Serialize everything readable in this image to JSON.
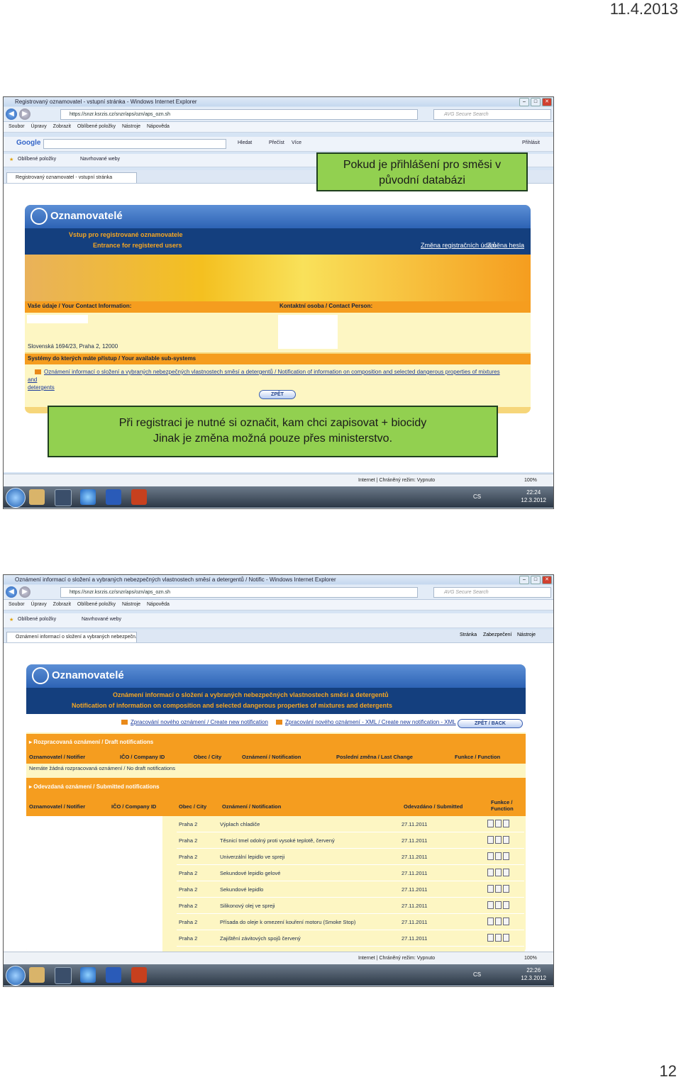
{
  "page": {
    "date": "11.4.2013",
    "number": "12"
  },
  "shot1": {
    "window_title": "Registrovaný oznamovatel - vstupní stránka - Windows Internet Explorer",
    "url": "https://snzr.ksrzis.cz/snzr/aps/ozn/aps_ozn.sh",
    "search_placeholder": "AVG Secure Search",
    "menu": [
      "Soubor",
      "Úpravy",
      "Zobrazit",
      "Oblíbené položky",
      "Nástroje",
      "Nápověda"
    ],
    "google_label": "Google",
    "google_hledat": "Hledat",
    "google_precist": "Přečíst",
    "google_vice": "Více",
    "google_prihlasit": "Přihlásit",
    "fav_label": "Oblíbené položky",
    "fav_suggested": "Navrhované weby",
    "tab_label": "Registrovaný oznamovatel - vstupní stránka",
    "app_name": "Oznamovatelé",
    "band_line1": "Vstup pro registrované oznamovatele",
    "band_line2": "Entrance for registered users",
    "link_change_reg": "Změna registračních údajů",
    "link_change_pwd": "Změna hesla",
    "contact_info_label": "Vaše údaje / Your Contact Information:",
    "contact_person_label": "Kontaktní osoba / Contact Person:",
    "address": "Slovenská 1694/23, Praha 2, 12000",
    "subsystems_label": "Systémy do kterých máte přístup / Your available sub-systems",
    "subsystem_link_line1": "Oznámení informací o složení a vybraných nebezpečných vlastnostech směsí a detergentů / Notification of information on composition and selected dangerous properties of mixtures and",
    "subsystem_link_line2": "detergents",
    "back_button": "ZPĚT",
    "status_zone": "Internet | Chráněný režim: Vypnuto",
    "zoom": "100%",
    "lang": "CS",
    "clock_time": "22:24",
    "clock_date": "12.3.2012"
  },
  "callout_top": {
    "line1": "Pokud je přihlášení pro směsi v",
    "line2": "původní databázi"
  },
  "callout_mid": {
    "line1": "Při registraci je nutné si označit, kam chci zapisovat + biocidy",
    "line2": "Jinak je změna možná pouze přes ministerstvo."
  },
  "shot2": {
    "window_title": "Oznámení informací o složení a vybraných nebezpečných vlastnostech směsí a detergentů / Notific - Windows Internet Explorer",
    "url": "https://snzr.ksrzis.cz/snzr/aps/ozn/aps_ozn.sh",
    "search_placeholder": "AVG Secure Search",
    "menu": [
      "Soubor",
      "Úpravy",
      "Zobrazit",
      "Oblíbené položky",
      "Nástroje",
      "Nápověda"
    ],
    "fav_label": "Oblíbené položky",
    "fav_suggested": "Navrhované weby",
    "tab_label": "Oznámení informací o složení a vybraných nebezpečn...",
    "cmd_stranka": "Stránka",
    "cmd_zabezpeceni": "Zabezpečení",
    "cmd_nastroje": "Nástroje",
    "app_name": "Oznamovatelé",
    "band_line1": "Oznámení informací o složení a vybraných nebezpečných vlastnostech směsí a detergentů",
    "band_line2": "Notification of information on composition and selected dangerous properties of mixtures and detergents",
    "action_new": "Zpracování nového oznámení / Create new notification",
    "action_xml": "Zpracování nového oznámení - XML / Create new notification - XML",
    "back_button": "ZPĚT / BACK",
    "draft_header": "Rozpracovaná oznámení / Draft notifications",
    "draft_columns": [
      "Oznamovatel / Notifier",
      "IČO / Company ID",
      "Obec / City",
      "Oznámení / Notification",
      "Poslední změna / Last Change",
      "Funkce / Function"
    ],
    "draft_empty": "Nemáte žádná rozpracovaná oznámení / No draft notifications",
    "submitted_header": "Odevzdaná oznámení / Submitted notifications",
    "submitted_columns": [
      "Oznamovatel / Notifier",
      "IČO / Company ID",
      "Obec / City",
      "Oznámení / Notification",
      "Odevzdáno / Submitted",
      "Funkce / Function"
    ],
    "rows": [
      {
        "city": "Praha 2",
        "notification": "Výplach chladiče",
        "submitted": "27.11.2011"
      },
      {
        "city": "Praha 2",
        "notification": "Těsnicí tmel odolný proti vysoké teplotě, červený",
        "submitted": "27.11.2011"
      },
      {
        "city": "Praha 2",
        "notification": "Univerzální lepidlo ve spreji",
        "submitted": "27.11.2011"
      },
      {
        "city": "Praha 2",
        "notification": "Sekundové lepidlo gelové",
        "submitted": "27.11.2011"
      },
      {
        "city": "Praha 2",
        "notification": "Sekundové lepidlo",
        "submitted": "27.11.2011"
      },
      {
        "city": "Praha 2",
        "notification": "Silikonový olej ve spreji",
        "submitted": "27.11.2011"
      },
      {
        "city": "Praha 2",
        "notification": "Přísada do oleje k omezení kouření motoru (Smoke Stop)",
        "submitted": "27.11.2011"
      },
      {
        "city": "Praha 2",
        "notification": "Zajištění závitových spojů červený",
        "submitted": "27.11.2011"
      }
    ],
    "status_zone": "Internet | Chráněný režim: Vypnuto",
    "zoom": "100%",
    "lang": "CS",
    "clock_time": "22:26",
    "clock_date": "12.3.2012"
  }
}
